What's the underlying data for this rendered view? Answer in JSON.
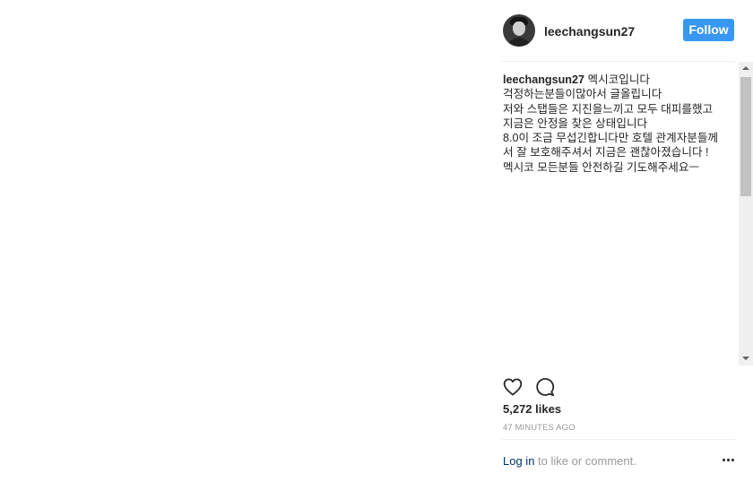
{
  "post": {
    "username": "leechangsun27",
    "follow_label": "Follow",
    "caption_text": " 멕시코입니다\n걱정하는분들이많아서 글올립니다\n저와 스탭들은 지진을느끼고 모두 대피를했고 지금은 안정을 찾은 상태입니다\n8.0이 조금 무섭긴합니다만 호텔 관계자분들께서 잘 보호해주셔서 지금은 괜찮아졌습니다 !\n멕시코 모든분들 안전하길 기도해주세요ㅡ",
    "likes": "5,272 likes",
    "timestamp": "47 MINUTES AGO",
    "login_link": "Log in",
    "login_suffix": " to like or comment."
  },
  "icons": {
    "like": "heart-icon",
    "comment": "comment-icon",
    "more": "more-options-icon"
  },
  "colors": {
    "follow_button": "#3897f0",
    "login_link": "#003569",
    "secondary_text": "#999999"
  }
}
